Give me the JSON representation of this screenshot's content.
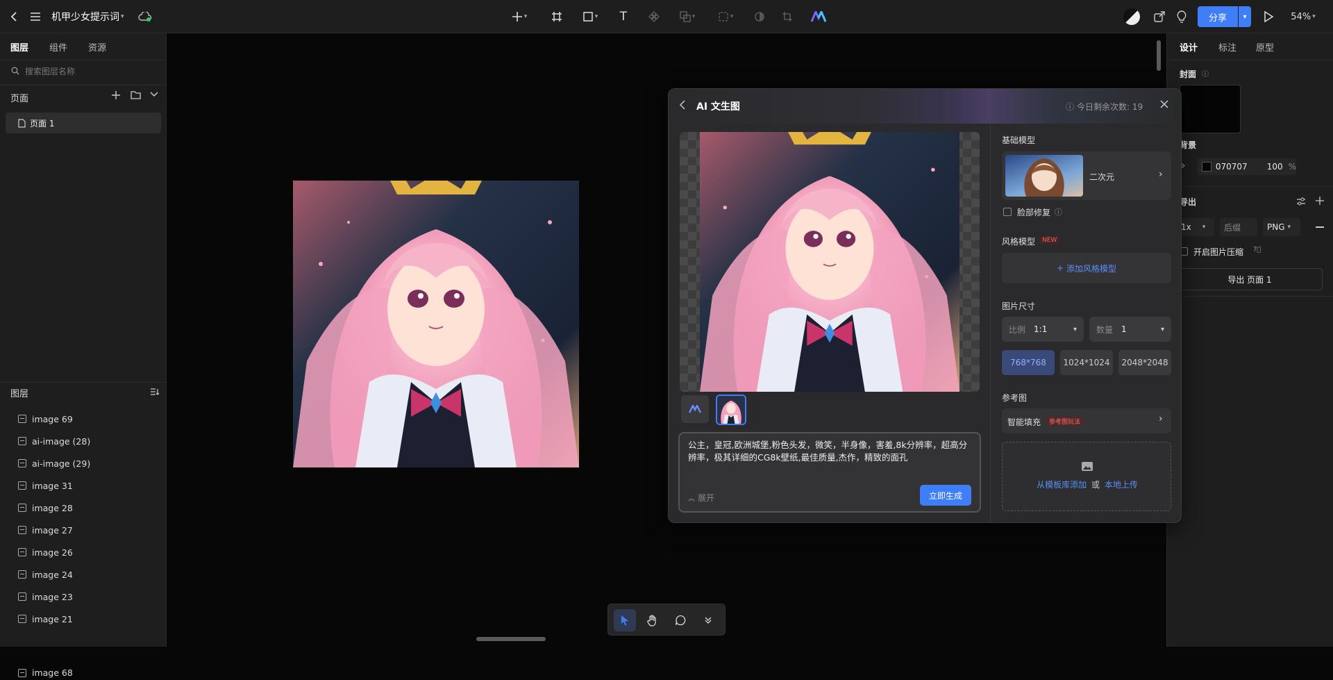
{
  "topbar": {
    "file_title": "机甲少女提示词",
    "share_label": "分享",
    "zoom": "54%"
  },
  "left_panel": {
    "tabs": [
      "图层",
      "组件",
      "资源"
    ],
    "search_placeholder": "搜索图层名称",
    "pages_title": "页面",
    "page_item": "页面 1",
    "layers_title": "图层",
    "layers": [
      "image 69",
      "ai-image (28)",
      "ai-image (29)",
      "image 31",
      "image 28",
      "image 27",
      "image 26",
      "image 24",
      "image 23",
      "image 21",
      "image 68"
    ]
  },
  "right_panel": {
    "tabs": [
      "设计",
      "标注",
      "原型"
    ],
    "cover_label": "封面",
    "background_label": "背景",
    "bg_color": "070707",
    "bg_opacity": "100",
    "bg_percent": "%",
    "export_label": "导出",
    "export_scale": "1x",
    "export_suffix_placeholder": "后缀",
    "export_format": "PNG",
    "compress_label": "开启图片压缩",
    "export_button": "导出 页面 1"
  },
  "dialog": {
    "title": "AI 文生图",
    "remaining": "今日剩余次数: 19",
    "base_model_label": "基础模型",
    "base_model_name": "二次元",
    "face_fix_label": "脸部修复",
    "style_model_label": "风格模型",
    "new_badge": "NEW",
    "add_style": "添加风格模型",
    "size_label": "图片尺寸",
    "ratio_label": "比例",
    "ratio_value": "1:1",
    "count_label": "数量",
    "count_value": "1",
    "sizes": [
      "768*768",
      "1024*1024",
      "2048*2048"
    ],
    "reference_label": "参考图",
    "smart_fill": "智能填充",
    "reference_badge": "参考图玩法",
    "upload_from_template": "从模板库添加",
    "upload_or": "或",
    "upload_local": "本地上传",
    "prompt": "公主，皇冠,欧洲城堡,粉色头发，微笑，半身像，害羞,8k分辨率，超高分辨率，极其详细的CG8k壁纸,最佳质量,杰作，精致的面孔",
    "expand_label": "展开",
    "generate_label": "立即生成"
  },
  "colors": {
    "accent": "#3e7ef7",
    "canvas": "#070707",
    "panel": "#1e1e1e"
  }
}
